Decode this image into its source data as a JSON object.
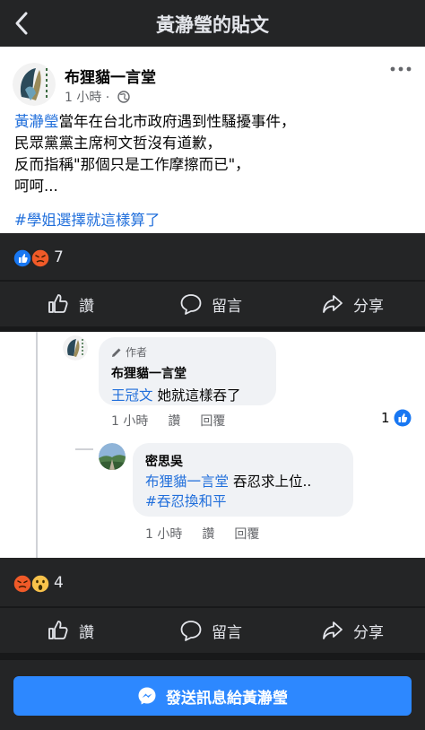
{
  "header": {
    "title": "黃瀞瑩的貼文"
  },
  "post": {
    "author": "布狸貓一言堂",
    "time": "1 小時 ·",
    "mention": "黃瀞瑩",
    "text_line1": "當年在台北市政府遇到性騷擾事件，",
    "text_line2": "民眾黨黨主席柯文哲沒有道歉，",
    "text_line3": "反而指稱\"那個只是工作摩擦而已\"，",
    "text_line4": "呵呵...",
    "hashtag": "#學姐選擇就這樣算了",
    "reaction_count": "7"
  },
  "actions": {
    "like": "讚",
    "comment": "留言",
    "share": "分享"
  },
  "comments": [
    {
      "badge": "作者",
      "name": "布狸貓一言堂",
      "mention": "王冠文",
      "text": " 她就這樣吞了",
      "time": "1 小時",
      "like": "讚",
      "reply": "回覆",
      "like_count": "1"
    },
    {
      "name": "密思吳",
      "mention": "布狸貓一言堂",
      "text": " 吞忍求上位..",
      "hashtag": "#吞忍換和平",
      "time": "1 小時",
      "like": "讚",
      "reply": "回覆"
    }
  ],
  "second_post": {
    "reaction_count": "4"
  },
  "message_button": {
    "label": "發送訊息給黃瀞瑩"
  },
  "colors": {
    "link": "#216fdb",
    "messenger_button": "#2d88ff",
    "dark_bg": "#242526"
  }
}
